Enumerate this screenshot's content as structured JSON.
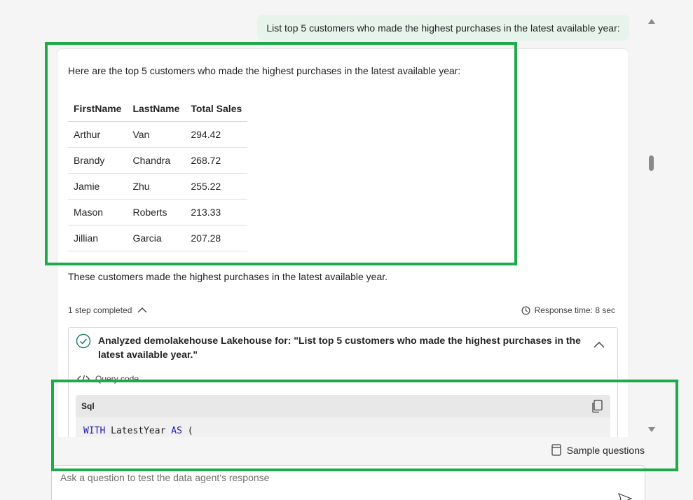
{
  "user_message": "List top 5 customers who made the highest purchases in the latest available year:",
  "answer": {
    "intro": "Here are the top 5 customers who made the highest purchases in the latest available year:",
    "table": {
      "headers": [
        "FirstName",
        "LastName",
        "Total Sales"
      ],
      "rows": [
        [
          "Arthur",
          "Van",
          "294.42"
        ],
        [
          "Brandy",
          "Chandra",
          "268.72"
        ],
        [
          "Jamie",
          "Zhu",
          "255.22"
        ],
        [
          "Mason",
          "Roberts",
          "213.33"
        ],
        [
          "Jillian",
          "Garcia",
          "207.28"
        ]
      ]
    },
    "outro": "These customers made the highest purchases in the latest available year."
  },
  "steps": {
    "completed_label": "1 step completed",
    "response_time_label": "Response time: 8 sec",
    "step_title": "Analyzed demolakehouse Lakehouse for: \"List top 5 customers who made the highest purchases in the latest available year.\"",
    "query_code_label": "Query code",
    "code_language": "Sql",
    "code_tokens": {
      "kw1": "WITH",
      "ident": "LatestYear",
      "kw2": "AS",
      "paren": "("
    }
  },
  "bottom_bar": {
    "sample_questions_label": "Sample questions"
  },
  "ask_input": {
    "placeholder": "Ask a question to test the data agent's response",
    "value": ""
  },
  "colors": {
    "accent_green": "#1faa4a",
    "user_bubble": "#e6f4ec",
    "sql_keyword": "#1a1aa6"
  },
  "icons": [
    "chevron-up-icon",
    "clock-icon",
    "check-circle-icon",
    "code-icon",
    "copy-icon",
    "sample-questions-icon",
    "send-icon",
    "scroll-up-icon",
    "scroll-down-icon"
  ]
}
